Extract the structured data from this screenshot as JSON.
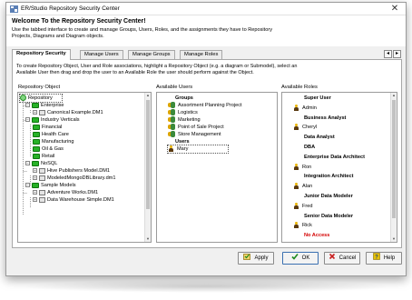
{
  "window": {
    "title": "ER/Studio Repository Security Center",
    "close_glyph": "✕"
  },
  "header": {
    "welcome": "Welcome To the Repository Security Center!",
    "description": "Use the tabbed interface to create and manage Groups, Users, Roles, and the assignments they have to Repository Projects, Diagrams and Diagram objects."
  },
  "tabs": [
    {
      "label": "Repository Security",
      "active": true
    },
    {
      "label": "Manage Users",
      "active": false
    },
    {
      "label": "Manage Groups",
      "active": false
    },
    {
      "label": "Manage Roles",
      "active": false
    }
  ],
  "tab_nav": {
    "prev": "◂",
    "next": "▸"
  },
  "instructions": "To create Repository Object, User and Role associations, highlight a Repository Object (e.g. a diagram or Submodel), select an Available User then drag and drop the user to an Available Role the user should perform against the Object.",
  "columns": {
    "repository_object": "Repository Object",
    "available_users": "Available Users",
    "available_roles": "Available Roles"
  },
  "repository_tree": [
    {
      "label": "Repository",
      "type": "root",
      "indent": 0
    },
    {
      "label": "Enterprise",
      "type": "folder",
      "indent": 1
    },
    {
      "label": "Canonical Example.DM1",
      "type": "doc",
      "indent": 2
    },
    {
      "label": "Industry Verticals",
      "type": "folder",
      "indent": 1
    },
    {
      "label": "Financial",
      "type": "folder",
      "indent": 2
    },
    {
      "label": "Health Care",
      "type": "folder",
      "indent": 2
    },
    {
      "label": "Manufacturing",
      "type": "folder",
      "indent": 2
    },
    {
      "label": "Oil & Gas",
      "type": "folder",
      "indent": 2
    },
    {
      "label": "Retail",
      "type": "folder",
      "indent": 2
    },
    {
      "label": "NoSQL",
      "type": "folder",
      "indent": 1
    },
    {
      "label": "Hive Publishers Model.DM1",
      "type": "doc",
      "indent": 2
    },
    {
      "label": "ModeledMongoDBLibrary.dm1",
      "type": "doc",
      "indent": 2
    },
    {
      "label": "Sample Models",
      "type": "folder",
      "indent": 1
    },
    {
      "label": "Adventure Works.DM1",
      "type": "doc",
      "indent": 2
    },
    {
      "label": "Data Warehouse Simple.DM1",
      "type": "doc",
      "indent": 2
    }
  ],
  "users_list": [
    {
      "label": "Groups",
      "type": "heading"
    },
    {
      "label": "Assortment Planning Project",
      "type": "group"
    },
    {
      "label": "Logistics",
      "type": "group"
    },
    {
      "label": "Marketing",
      "type": "group"
    },
    {
      "label": "Point of Sale Project",
      "type": "group"
    },
    {
      "label": "Store Management",
      "type": "group"
    },
    {
      "label": "Users",
      "type": "heading"
    },
    {
      "label": "Mary",
      "type": "user",
      "selected": true
    }
  ],
  "roles_list": [
    {
      "label": "Super User",
      "type": "heading"
    },
    {
      "label": "Admin",
      "type": "user"
    },
    {
      "label": "Business Analyst",
      "type": "heading"
    },
    {
      "label": "Cheryl",
      "type": "user"
    },
    {
      "label": "Data Analyst",
      "type": "heading"
    },
    {
      "label": "DBA",
      "type": "heading"
    },
    {
      "label": "Enterprise Data Architect",
      "type": "heading"
    },
    {
      "label": "Ron",
      "type": "user"
    },
    {
      "label": "Integration Architect",
      "type": "heading"
    },
    {
      "label": "Alan",
      "type": "user"
    },
    {
      "label": "Junior Data Modeler",
      "type": "heading"
    },
    {
      "label": "Fred",
      "type": "user"
    },
    {
      "label": "Senior Data Modeler",
      "type": "heading"
    },
    {
      "label": "Rick",
      "type": "user"
    },
    {
      "label": "No Access",
      "type": "noaccess"
    }
  ],
  "buttons": {
    "apply": "Apply",
    "ok": "OK",
    "cancel": "Cancel",
    "help": "Help"
  },
  "colors": {
    "folder_green": "#27b127",
    "no_access_red": "#d40000",
    "ok_check": "#1e8a1e",
    "cancel_x": "#c81e1e",
    "help_yellow": "#e8c200"
  }
}
